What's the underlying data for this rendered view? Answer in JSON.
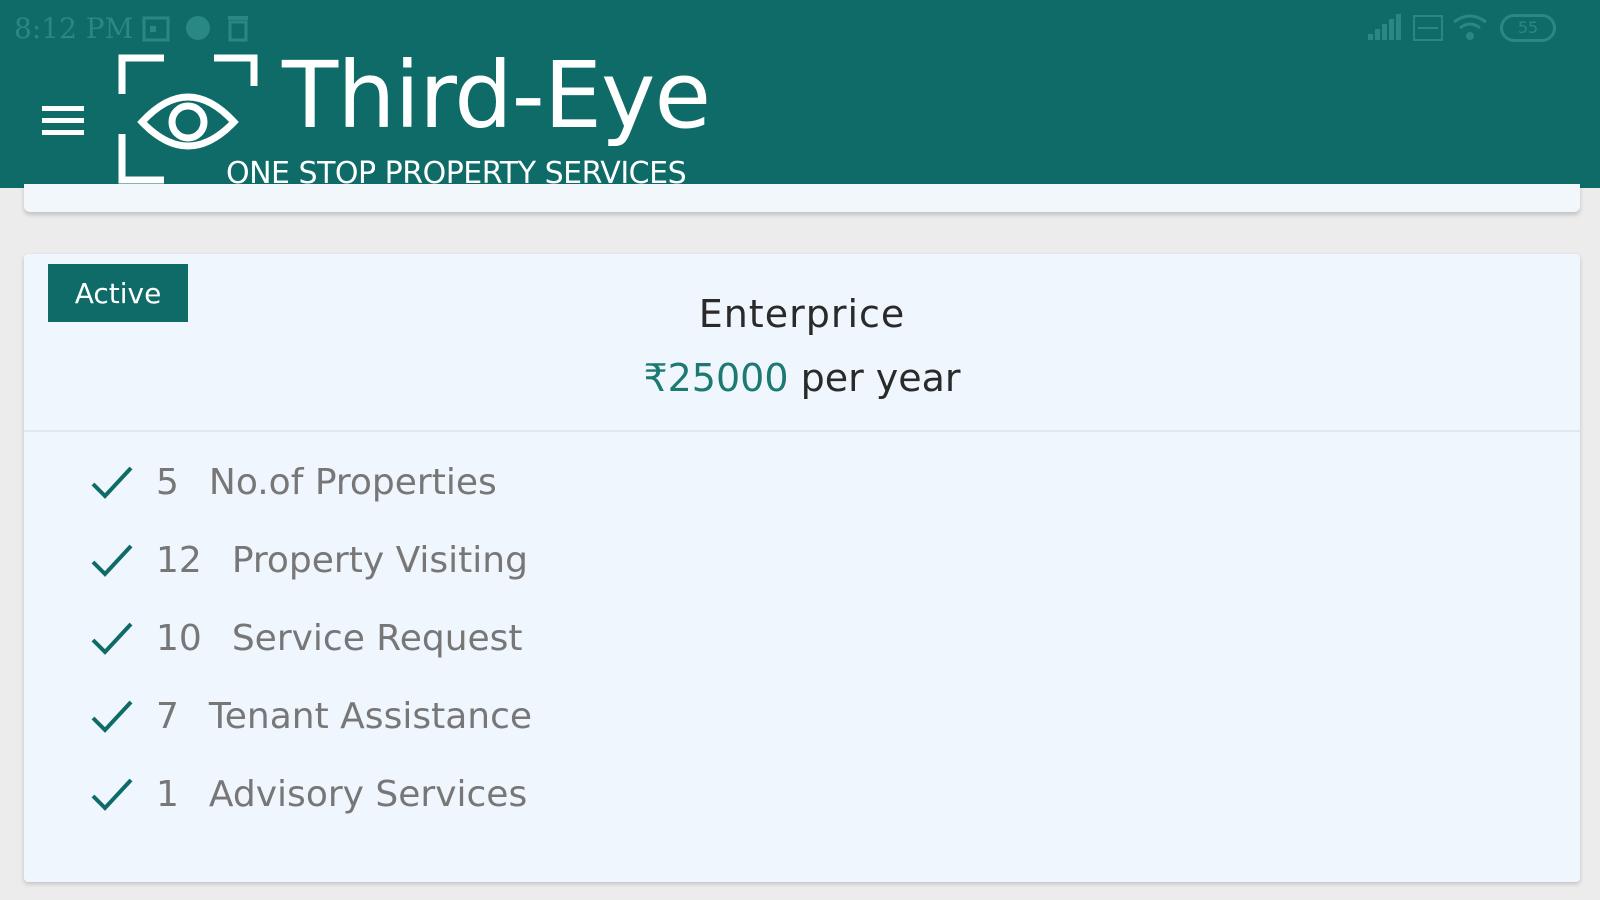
{
  "status_bar": {
    "time": "8:12 PM",
    "battery": "55",
    "icons": [
      "calendar-icon",
      "whatsapp-icon",
      "trash-icon",
      "signal-icon",
      "volte-icon",
      "wifi-icon",
      "battery-icon"
    ]
  },
  "app_bar": {
    "menu_icon": "hamburger-menu-icon",
    "logo_title": "Third-Eye",
    "logo_subtitle": "ONE STOP PROPERTY SERVICES",
    "background_color": "#0e6b67"
  },
  "plan": {
    "badge": "Active",
    "name": "Enterprice",
    "price_amount": "₹25000",
    "price_period": " per year",
    "features": [
      {
        "count": "5",
        "label": "No.of Properties"
      },
      {
        "count": "12",
        "label": "Property Visiting"
      },
      {
        "count": "10",
        "label": "Service Request"
      },
      {
        "count": "7",
        "label": "Tenant Assistance"
      },
      {
        "count": "1",
        "label": "Advisory Services"
      }
    ]
  },
  "colors": {
    "accent": "#0e6b67",
    "price": "#1d7a73",
    "card_background": "#eff6fd",
    "page_background": "#ececec"
  }
}
